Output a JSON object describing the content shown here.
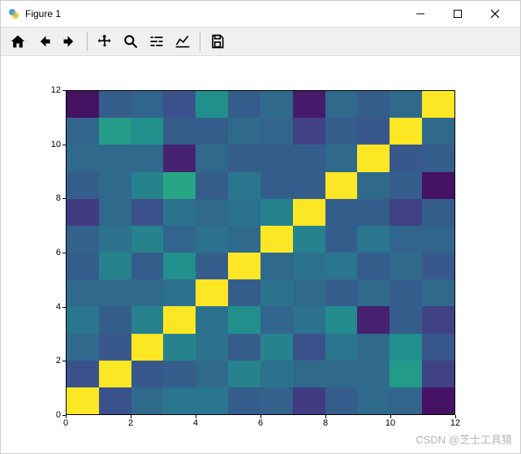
{
  "window": {
    "title": "Figure 1",
    "min_label": "Minimize",
    "max_label": "Maximize",
    "close_label": "Close"
  },
  "toolbar": {
    "home": "Home",
    "back": "Back",
    "forward": "Forward",
    "pan": "Pan",
    "zoom": "Zoom",
    "subplots": "Configure subplots",
    "axes": "Edit axes",
    "save": "Save"
  },
  "watermark": "CSDN @芝士工具猿",
  "chart_data": {
    "type": "heatmap",
    "title": "",
    "xlabel": "",
    "ylabel": "",
    "xlim": [
      0,
      12
    ],
    "ylim": [
      0,
      12
    ],
    "xticks": [
      0,
      2,
      4,
      6,
      8,
      10,
      12
    ],
    "yticks": [
      0,
      2,
      4,
      6,
      8,
      10,
      12
    ],
    "n": 12,
    "colormap": "viridis",
    "values": [
      [
        1.0,
        0.25,
        0.35,
        0.4,
        0.4,
        0.3,
        0.32,
        0.18,
        0.3,
        0.35,
        0.33,
        0.05
      ],
      [
        0.25,
        1.0,
        0.28,
        0.3,
        0.35,
        0.45,
        0.38,
        0.35,
        0.35,
        0.35,
        0.55,
        0.2
      ],
      [
        0.35,
        0.28,
        1.0,
        0.45,
        0.38,
        0.3,
        0.45,
        0.25,
        0.4,
        0.35,
        0.5,
        0.28
      ],
      [
        0.4,
        0.3,
        0.45,
        1.0,
        0.38,
        0.5,
        0.33,
        0.38,
        0.48,
        0.1,
        0.3,
        0.2
      ],
      [
        0.35,
        0.35,
        0.35,
        0.38,
        1.0,
        0.3,
        0.38,
        0.35,
        0.3,
        0.35,
        0.3,
        0.35
      ],
      [
        0.3,
        0.45,
        0.3,
        0.5,
        0.3,
        1.0,
        0.35,
        0.38,
        0.4,
        0.3,
        0.35,
        0.28
      ],
      [
        0.32,
        0.38,
        0.45,
        0.33,
        0.38,
        0.35,
        1.0,
        0.45,
        0.3,
        0.4,
        0.33,
        0.33
      ],
      [
        0.18,
        0.35,
        0.25,
        0.38,
        0.35,
        0.38,
        0.45,
        1.0,
        0.3,
        0.3,
        0.2,
        0.3
      ],
      [
        0.3,
        0.35,
        0.45,
        0.6,
        0.3,
        0.4,
        0.3,
        0.3,
        1.0,
        0.35,
        0.3,
        0.05
      ],
      [
        0.35,
        0.35,
        0.35,
        0.1,
        0.35,
        0.3,
        0.3,
        0.3,
        0.35,
        1.0,
        0.28,
        0.3
      ],
      [
        0.33,
        0.55,
        0.5,
        0.3,
        0.3,
        0.35,
        0.33,
        0.2,
        0.3,
        0.28,
        1.0,
        0.35
      ],
      [
        0.05,
        0.3,
        0.33,
        0.25,
        0.5,
        0.3,
        0.35,
        0.08,
        0.35,
        0.3,
        0.35,
        1.0
      ]
    ]
  }
}
